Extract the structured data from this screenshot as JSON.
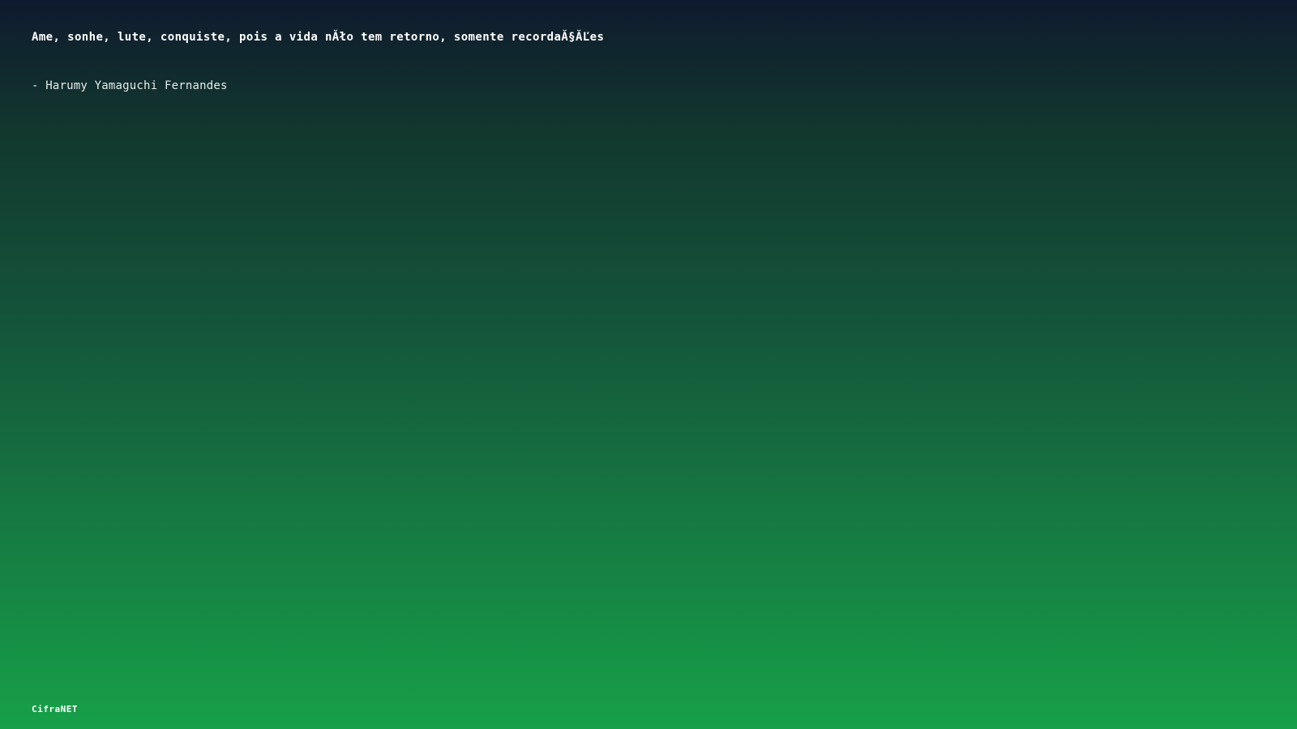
{
  "quote": {
    "text": "Ame, sonhe, lute, conquiste, pois a vida nĂło tem retorno, somente recordaĂ§ĂĽes",
    "author": "- Harumy Yamaguchi Fernandes"
  },
  "footer": {
    "brand": "CifraNET"
  },
  "colors": {
    "gradient_top": "#0f1a2e",
    "gradient_bottom": "#17a049",
    "text": "#ffffff"
  }
}
